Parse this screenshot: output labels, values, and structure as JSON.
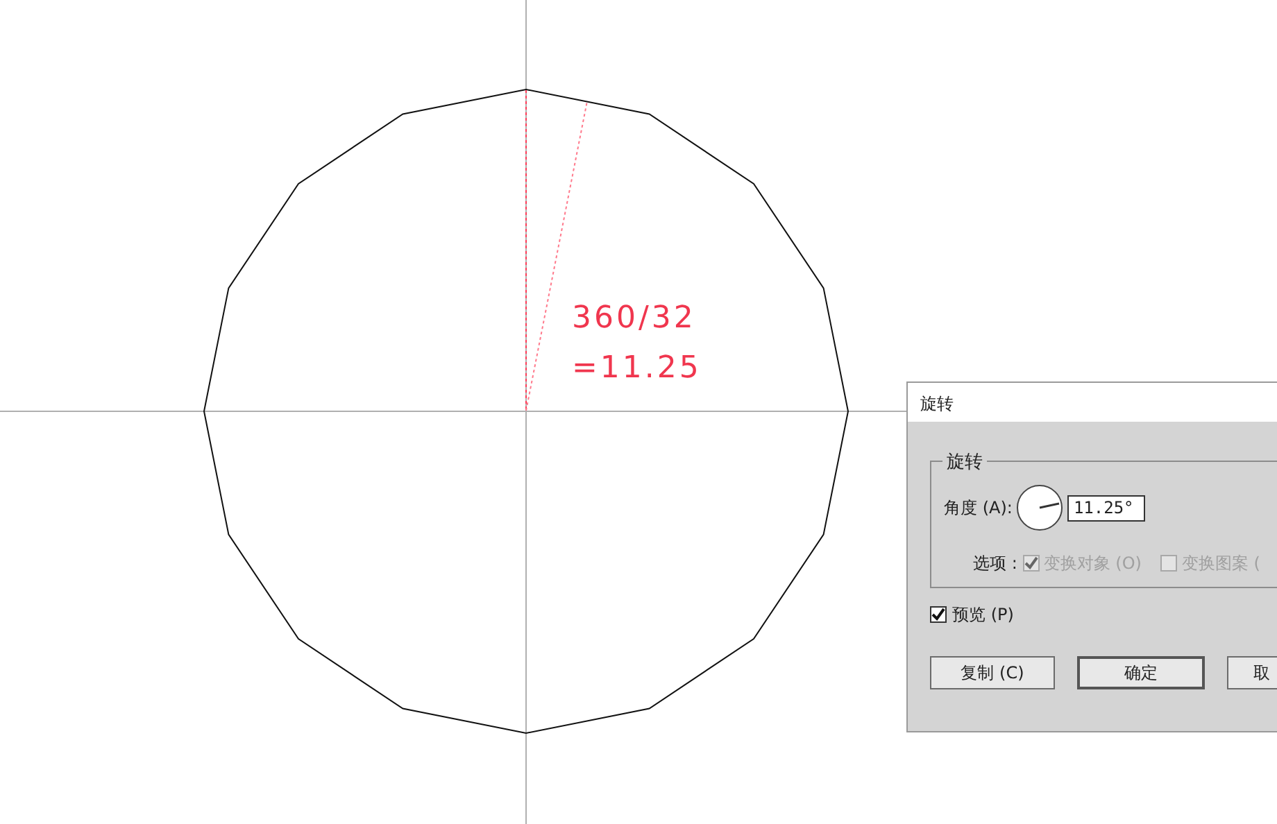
{
  "canvas": {
    "annotation_lines": [
      "360/32",
      "=11.25"
    ]
  },
  "dialog": {
    "title": "旋转",
    "group_title": "旋转",
    "angle_label": "角度 (A):",
    "angle_value": "11.25°",
    "options_label": "选项 :",
    "options": [
      {
        "label": "变换对象 (O)",
        "checked": true,
        "disabled": true
      },
      {
        "label": "变换图案 (",
        "checked": false,
        "disabled": true
      }
    ],
    "preview": {
      "label": "预览 (P)",
      "checked": true
    },
    "buttons": [
      {
        "label": "复制 (C)",
        "default": false
      },
      {
        "label": "确定",
        "default": true
      },
      {
        "label": "取",
        "default": false
      }
    ]
  }
}
